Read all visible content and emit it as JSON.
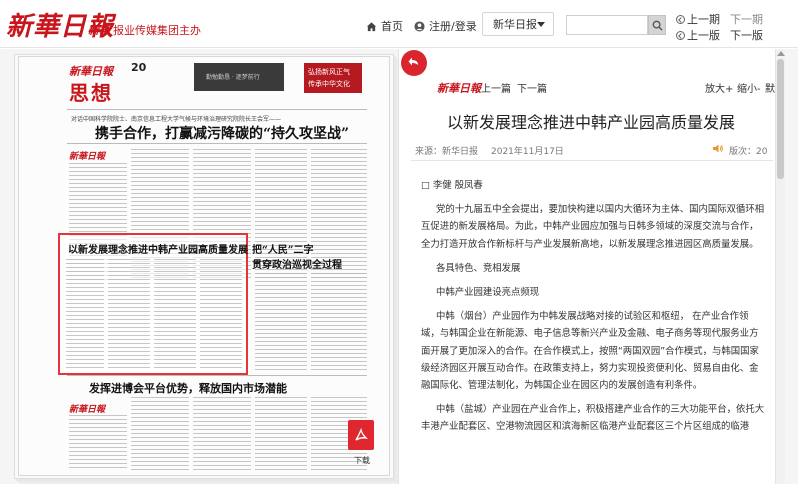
{
  "header": {
    "logo_text": "新華日報",
    "logo_sub_mini": "新華",
    "logo_sub": "报业传媒集团主办",
    "home_label": "首页",
    "login_label": "注册/登录",
    "paper_select": "新华日报",
    "search_placeholder": "",
    "prev_issue": "上一期",
    "next_issue": "下一期",
    "prev_page": "上一版",
    "next_page": "下一版"
  },
  "newspaper": {
    "masthead": "新華日報",
    "page_number": "20",
    "section": "思想",
    "banner_dark_text": "勤勉勤恳 · 逐梦前行",
    "banner_red_text": "弘扬新风正气 传承中华文化",
    "kicker": "对话中国科学院院士、南京信息工程大学气候与环境治理研究院院长王会军——",
    "headline": "携手合作，打赢减污降碳的“持久攻坚战”",
    "highlight_title": "以新发展理念推进中韩产业园高质量发展",
    "right_head_1": "把“人民”二字",
    "right_head_2": "贯穿政治巡视全过程",
    "bottom_head": "发挥进博会平台优势，释放国内市场潜能",
    "download_label": "下载"
  },
  "reader": {
    "logo": "新華日報",
    "prev_article": "上一篇",
    "next_article": "下一篇",
    "zoom_in": "放大+",
    "zoom_out": "缩小-",
    "default_size": "默认",
    "title": "以新发展理念推进中韩产业园高质量发展",
    "source": "来源：新华日报",
    "date": "2021年11月17日",
    "edition": "版次：20",
    "paragraphs": [
      "□ 李健  殷凤春",
      "党的十九届五中全会提出，要加快构建以国内大循环为主体、国内国际双循环相互促进的新发展格局。为此，中韩产业园应加强与日韩多领域的深度交流与合作，全力打造开放合作新标杆与产业发展新高地，以新发展理念推进园区高质量发展。",
      "各具特色、竞相发展",
      "中韩产业园建设亮点频现",
      "中韩（烟台）产业园作为中韩发展战略对接的试验区和枢纽， 在产业合作领域，与韩国企业在新能源、电子信息等新兴产业及金融、电子商务等现代服务业方面开展了更加深入的合作。在合作模式上，按照“两国双园”合作模式，与韩国国家级经济园区开展互动合作。在政策支持上，努力实现投资便利化、贸易自由化、金融国际化、管理法制化，为韩国企业在园区内的发展创造有利条件。",
      "中韩（盐城）产业园在产业合作上，积极搭建产业合作的三大功能平台，依托大丰港产业配套区、空港物流园区和滨海新区临港产业配套区三个片区组成的临港"
    ]
  },
  "colors": {
    "brand_red": "#c8161d",
    "highlight_border": "#e2363c",
    "pdf_red": "#e0262e"
  }
}
